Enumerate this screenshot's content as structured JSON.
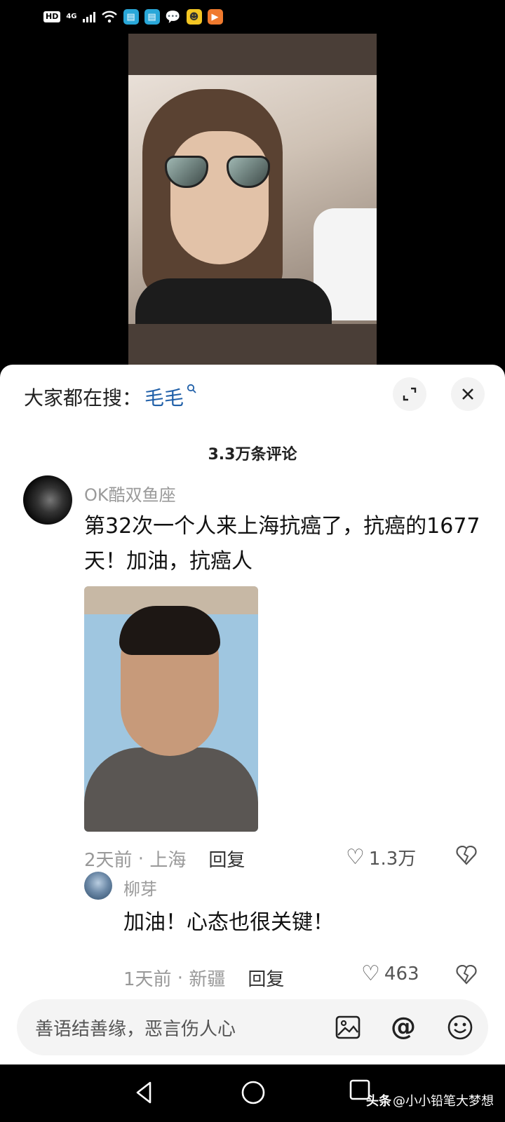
{
  "status_bar": {
    "hd": "HD",
    "network": "4G",
    "apps": [
      "book-app-icon",
      "book-app-icon",
      "wechat-icon",
      "qq-game-icon",
      "video-app-icon"
    ]
  },
  "search": {
    "prefix": "大家都在搜：",
    "keyword": "毛毛"
  },
  "comments_header": "3.3万条评论",
  "comments": [
    {
      "user": "OK酷双鱼座",
      "text": "第32次一个人来上海抗癌了，抗癌的1677天！加油，抗癌人",
      "time": "2天前",
      "location": "上海",
      "reply": "回复",
      "likes": "1.3万"
    }
  ],
  "replies": [
    {
      "user": "柳芽",
      "text": "加油！心态也很关键！",
      "time": "1天前",
      "location": "新疆",
      "reply": "回复",
      "likes": "463"
    }
  ],
  "input": {
    "placeholder": "善语结善缘，恶言伤人心"
  },
  "watermark": {
    "brand": "头条",
    "handle": "@小小铅笔大梦想"
  },
  "colors": {
    "keyword": "#1f5fa8",
    "sheet_bg": "#ffffff",
    "input_bg": "#f4f4f4"
  }
}
